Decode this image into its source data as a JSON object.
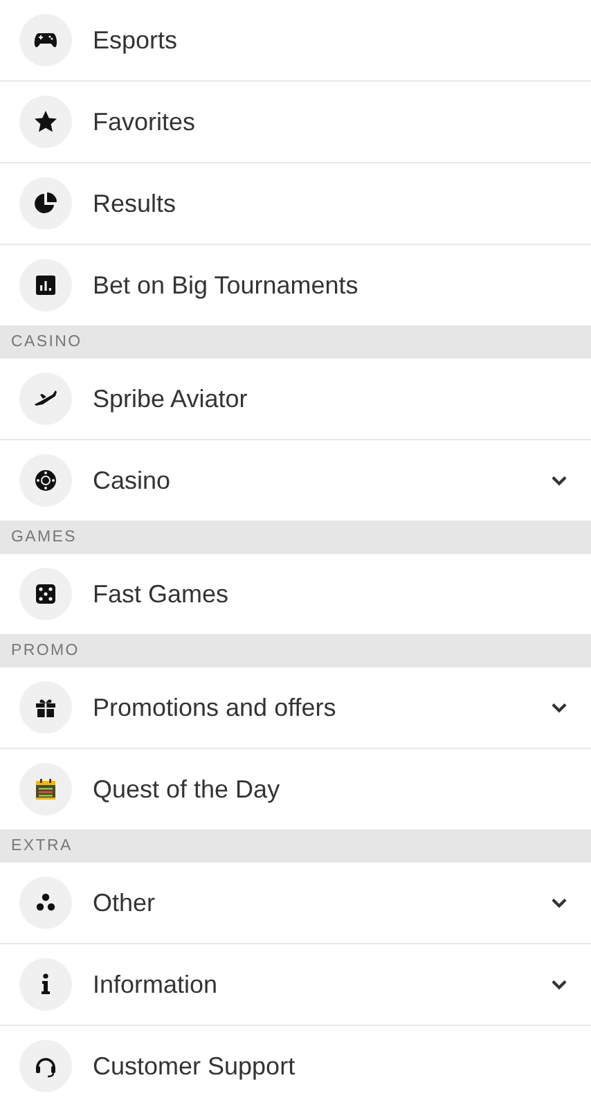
{
  "menu": [
    {
      "kind": "item",
      "label": "Esports",
      "submenu": false
    },
    {
      "kind": "item",
      "label": "Favorites",
      "submenu": false
    },
    {
      "kind": "item",
      "label": "Results",
      "submenu": false
    },
    {
      "kind": "item",
      "label": "Bet on Big Tournaments",
      "submenu": false
    },
    {
      "kind": "section",
      "label": "CASINO"
    },
    {
      "kind": "item",
      "label": "Spribe Aviator",
      "submenu": false
    },
    {
      "kind": "item",
      "label": "Casino",
      "submenu": true
    },
    {
      "kind": "section",
      "label": "GAMES"
    },
    {
      "kind": "item",
      "label": "Fast Games",
      "submenu": false
    },
    {
      "kind": "section",
      "label": "PROMO"
    },
    {
      "kind": "item",
      "label": "Promotions and offers",
      "submenu": true
    },
    {
      "kind": "item",
      "label": "Quest of the Day",
      "submenu": false
    },
    {
      "kind": "section",
      "label": "EXTRA"
    },
    {
      "kind": "item",
      "label": "Other",
      "submenu": true
    },
    {
      "kind": "item",
      "label": "Information",
      "submenu": true
    },
    {
      "kind": "item",
      "label": "Customer Support",
      "submenu": false
    }
  ]
}
